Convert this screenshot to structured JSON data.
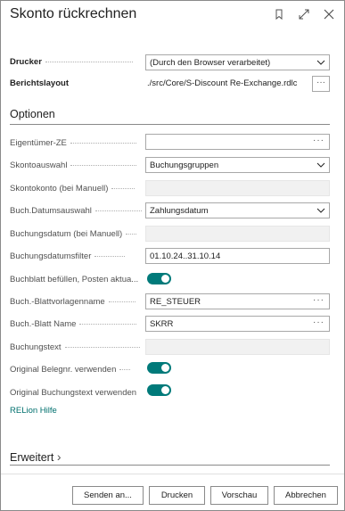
{
  "window": {
    "title": "Skonto rückrechnen",
    "icons": [
      "bookmark-icon",
      "expand-icon",
      "close-icon"
    ]
  },
  "printer": {
    "label": "Drucker",
    "value": "(Durch den Browser verarbeitet)"
  },
  "layout": {
    "label": "Berichtslayout",
    "value": "./src/Core/S-Discount Re-Exchange.rdlc",
    "more": "···"
  },
  "options": {
    "title": "Optionen",
    "fields": [
      {
        "label": "Eigentümer-ZE",
        "value": "",
        "more": "···"
      },
      {
        "label": "Skontoauswahl",
        "value": "Buchungsgruppen"
      },
      {
        "label": "Skontokonto (bei Manuell)",
        "value": ""
      },
      {
        "label": "Buch.Datumsauswahl",
        "value": "Zahlungsdatum"
      },
      {
        "label": "Buchungsdatum (bei Manuell)",
        "value": ""
      },
      {
        "label": "Buchungsdatumsfilter",
        "value": "01.10.24..31.10.14"
      },
      {
        "label": "Buchblatt befüllen, Posten aktua...",
        "value": true
      },
      {
        "label": "Buch.-Blattvorlagenname",
        "value": "RE_STEUER",
        "more": "···"
      },
      {
        "label": "Buch.-Blatt Name",
        "value": "SKRR",
        "more": "···"
      },
      {
        "label": "Buchungstext",
        "value": ""
      },
      {
        "label": "Original Belegnr. verwenden",
        "value": true
      },
      {
        "label": "Original Buchungstext verwenden",
        "value": true
      }
    ],
    "help_link": "RELion Hilfe"
  },
  "advanced": {
    "title": "Erweitert",
    "chevron": "›"
  },
  "buttons": {
    "send": "Senden an...",
    "print": "Drucken",
    "preview": "Vorschau",
    "cancel": "Abbrechen"
  },
  "colors": {
    "accent": "#007a7a",
    "link": "#00706e"
  }
}
